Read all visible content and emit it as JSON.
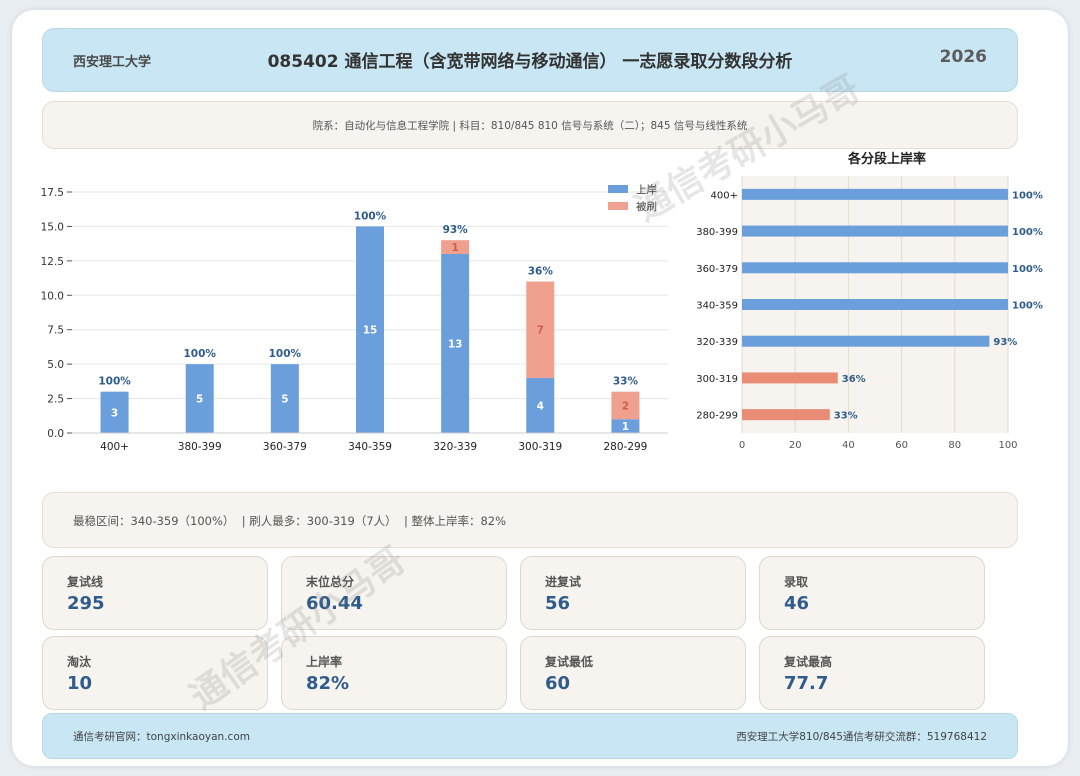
{
  "header": {
    "school": "西安理工大学",
    "title": "085402 通信工程（含宽带网络与移动通信） 一志愿录取分数段分析",
    "year": "2026"
  },
  "info_line": "院系：自动化与信息工程学院 | 科目：810/845 810 信号与系统（二）；845 信号与线性系统",
  "summary_line": "最稳区间：340-359（100%）  | 刷人最多：300-319（7人）  | 整体上岸率：82%",
  "stats": [
    {
      "label": "复试线",
      "value": "295"
    },
    {
      "label": "末位总分",
      "value": "60.44"
    },
    {
      "label": "进复试",
      "value": "56"
    },
    {
      "label": "录取",
      "value": "46"
    },
    {
      "label": "淘汰",
      "value": "10"
    },
    {
      "label": "上岸率",
      "value": "82%"
    },
    {
      "label": "复试最低",
      "value": "60"
    },
    {
      "label": "复试最高",
      "value": "77.7"
    }
  ],
  "footer": {
    "left": "通信考研官网：tongxinkaoyan.com",
    "right": "西安理工大学810/845通信考研交流群：519768412"
  },
  "watermark": "通信考研小马哥",
  "colors": {
    "admitted": "#6a9fdc",
    "rejected": "#f0a08f",
    "rate_low": "#e98c76",
    "pct_text": "#2f5c8c"
  },
  "chart_data": [
    {
      "type": "bar",
      "stacked": true,
      "categories": [
        "400+",
        "380-399",
        "360-379",
        "340-359",
        "320-339",
        "300-319",
        "280-299"
      ],
      "series": [
        {
          "name": "上岸",
          "values": [
            3,
            5,
            5,
            15,
            13,
            4,
            1
          ]
        },
        {
          "name": "被刷",
          "values": [
            0,
            0,
            0,
            0,
            1,
            7,
            2
          ]
        }
      ],
      "top_labels": [
        "100%",
        "100%",
        "100%",
        "100%",
        "93%",
        "36%",
        "33%"
      ],
      "ylim": [
        0,
        17.5
      ],
      "yticks": [
        "0.0",
        "2.5",
        "5.0",
        "7.5",
        "10.0",
        "12.5",
        "15.0",
        "17.5"
      ],
      "grid": true,
      "legend": "top-right"
    },
    {
      "type": "bar",
      "orientation": "horizontal",
      "title": "各分段上岸率",
      "categories": [
        "400+",
        "380-399",
        "360-379",
        "340-359",
        "320-339",
        "300-319",
        "280-299"
      ],
      "values": [
        100,
        100,
        100,
        100,
        93,
        36,
        33
      ],
      "value_labels": [
        "100%",
        "100%",
        "100%",
        "100%",
        "93%",
        "36%",
        "33%"
      ],
      "xlim": [
        0,
        100
      ],
      "xticks": [
        "0",
        "20",
        "40",
        "60",
        "80",
        "100"
      ],
      "grid": true
    }
  ]
}
